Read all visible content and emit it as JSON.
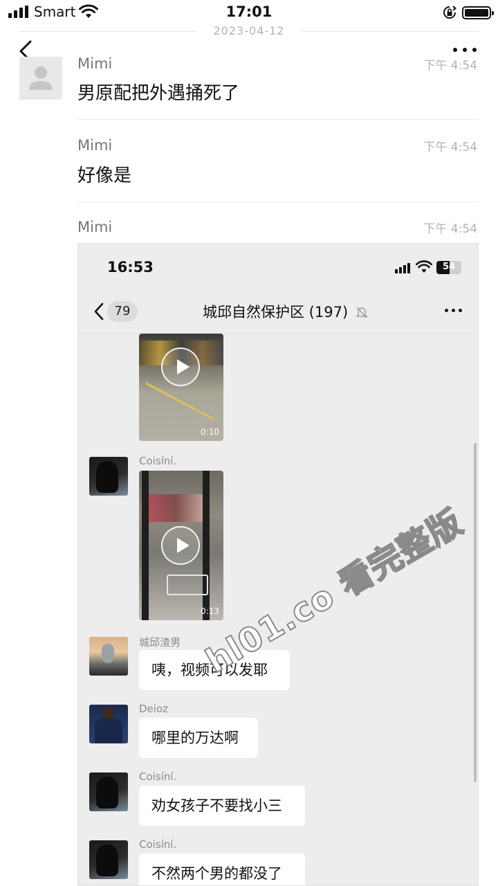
{
  "status_bar": {
    "carrier": "Smart",
    "time": "17:01"
  },
  "date_separator": "2023-04-12",
  "messages": [
    {
      "sender": "Mimi",
      "time": "下午 4:54",
      "text": "男原配把外遇捅死了"
    },
    {
      "sender": "Mimi",
      "time": "下午 4:54",
      "text": "好像是"
    },
    {
      "sender": "Mimi",
      "time": "下午 4:54",
      "image": "embedded-screenshot"
    }
  ],
  "embedded": {
    "status_time": "16:53",
    "battery_level": "54",
    "back_count": "79",
    "chat_title": "城邱自然保护区 (197)",
    "video_durations": [
      "0:10",
      "0:13"
    ],
    "chat": [
      {
        "sender": "Coisíní.",
        "type": "video"
      },
      {
        "sender": "城邱渣男",
        "text": "咦，视频可以发耶"
      },
      {
        "sender": "Deioz",
        "text": "哪里的万达啊"
      },
      {
        "sender": "Coisíní.",
        "text": "劝女孩子不要找小三"
      },
      {
        "sender": "Coisíní.",
        "text": "不然两个男的都没了"
      }
    ]
  },
  "watermark": "hl01.co 看完整版",
  "icons": {
    "back": "chevron-left-icon",
    "more": "more-dots-icon",
    "mute": "bell-muted-icon",
    "play": "play-icon"
  }
}
